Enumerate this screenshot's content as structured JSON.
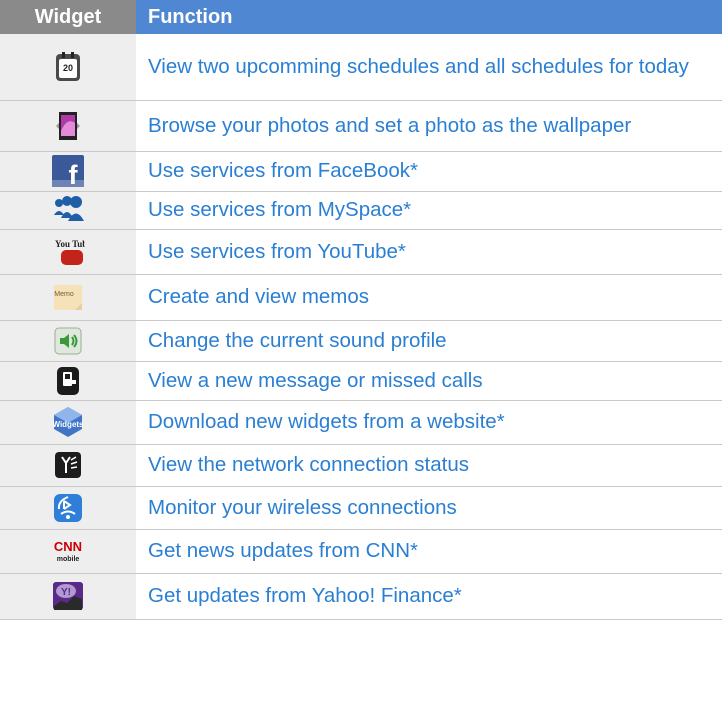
{
  "header": {
    "widget": "Widget",
    "function": "Function"
  },
  "rows": [
    {
      "icon": "calendar-icon",
      "text": "View two upcomming schedules and all schedules for today",
      "icon_text": "20"
    },
    {
      "icon": "photo-frame-icon",
      "text": "Browse your photos and set a photo as the wallpaper"
    },
    {
      "icon": "facebook-icon",
      "text": "Use services from FaceBook*",
      "icon_text": "f"
    },
    {
      "icon": "myspace-icon",
      "text": "Use services from MySpace*"
    },
    {
      "icon": "youtube-icon",
      "text": "Use services from YouTube*",
      "icon_text": "You Tube"
    },
    {
      "icon": "memo-icon",
      "text": "Create and view memos",
      "icon_text": "Memo"
    },
    {
      "icon": "speaker-icon",
      "text": "Change the current sound profile"
    },
    {
      "icon": "phone-message-icon",
      "text": "View a new message or missed calls"
    },
    {
      "icon": "widgets-download-icon",
      "text": "Download new widgets from a website*",
      "icon_text": "Widgets"
    },
    {
      "icon": "network-signal-icon",
      "text": "View the network connection status"
    },
    {
      "icon": "bluetooth-wifi-icon",
      "text": "Monitor your wireless connections"
    },
    {
      "icon": "cnn-icon",
      "text": "Get news updates from CNN*",
      "icon_text": "CNN mobile"
    },
    {
      "icon": "yahoo-finance-icon",
      "text": "Get updates from Yahoo! Finance*",
      "icon_text": "Y!"
    }
  ],
  "colors": {
    "header_widget_bg": "#8a8a8a",
    "header_function_bg": "#4f87d2",
    "text": "#2a7fd3",
    "icon_cell_bg": "#eeeeee"
  }
}
